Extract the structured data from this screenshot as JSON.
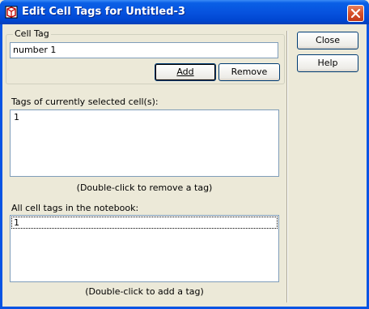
{
  "window": {
    "title": "Edit Cell Tags for Untitled-3"
  },
  "cell_tag": {
    "group_label": "Cell Tag",
    "value": "number 1",
    "add_label": "Add",
    "remove_label": "Remove"
  },
  "selected_tags": {
    "label": "Tags of currently selected cell(s):",
    "items": [
      "1"
    ],
    "hint": "(Double-click to remove a tag)"
  },
  "all_tags": {
    "label": "All cell tags in the notebook:",
    "items": [
      "1"
    ],
    "hint": "(Double-click to add a tag)"
  },
  "side_buttons": {
    "close_label": "Close",
    "help_label": "Help"
  }
}
